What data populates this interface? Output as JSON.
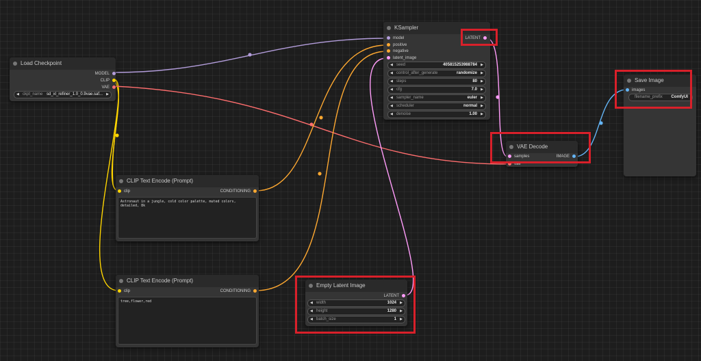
{
  "colors": {
    "model": "#b39ddb",
    "clip": "#ffd500",
    "vae": "#ff6e6e",
    "conditioning": "#ffa931",
    "latent": "#ff9cf9",
    "image": "#64b5f6",
    "highlight": "#d9202a"
  },
  "load_checkpoint": {
    "title": "Load Checkpoint",
    "outputs": [
      "MODEL",
      "CLIP",
      "VAE"
    ],
    "ckpt_label": "ckpt_name",
    "ckpt_value": "sd_xl_refiner_1.0_0.9vae.saf..."
  },
  "ksampler": {
    "title": "KSampler",
    "inputs": [
      "model",
      "positive",
      "negative",
      "latent_image"
    ],
    "output": "LATENT",
    "widgets": [
      {
        "label": "seed",
        "value": "405815253988784"
      },
      {
        "label": "control_after_generate",
        "value": "randomize"
      },
      {
        "label": "steps",
        "value": "80"
      },
      {
        "label": "cfg",
        "value": "7.0"
      },
      {
        "label": "sampler_name",
        "value": "euler"
      },
      {
        "label": "scheduler",
        "value": "normal"
      },
      {
        "label": "denoise",
        "value": "1.00"
      }
    ]
  },
  "save_image": {
    "title": "Save Image",
    "input": "images",
    "prefix_label": "filename_prefix",
    "prefix_value": "ComfyUI"
  },
  "vae_decode": {
    "title": "VAE Decode",
    "inputs": [
      "samples",
      "vae"
    ],
    "output": "IMAGE"
  },
  "clip_text_1": {
    "title": "CLIP Text Encode (Prompt)",
    "input": "clip",
    "output": "CONDITIONING",
    "text": "Astronaut in a jungle, cold color palette, muted colors, detailed, 8k"
  },
  "clip_text_2": {
    "title": "CLIP Text Encode (Prompt)",
    "input": "clip",
    "output": "CONDITIONING",
    "text": "tree,flower,red"
  },
  "empty_latent": {
    "title": "Empty Latent Image",
    "output": "LATENT",
    "widgets": [
      {
        "label": "width",
        "value": "1024"
      },
      {
        "label": "height",
        "value": "1280"
      },
      {
        "label": "batch_size",
        "value": "1"
      }
    ]
  }
}
